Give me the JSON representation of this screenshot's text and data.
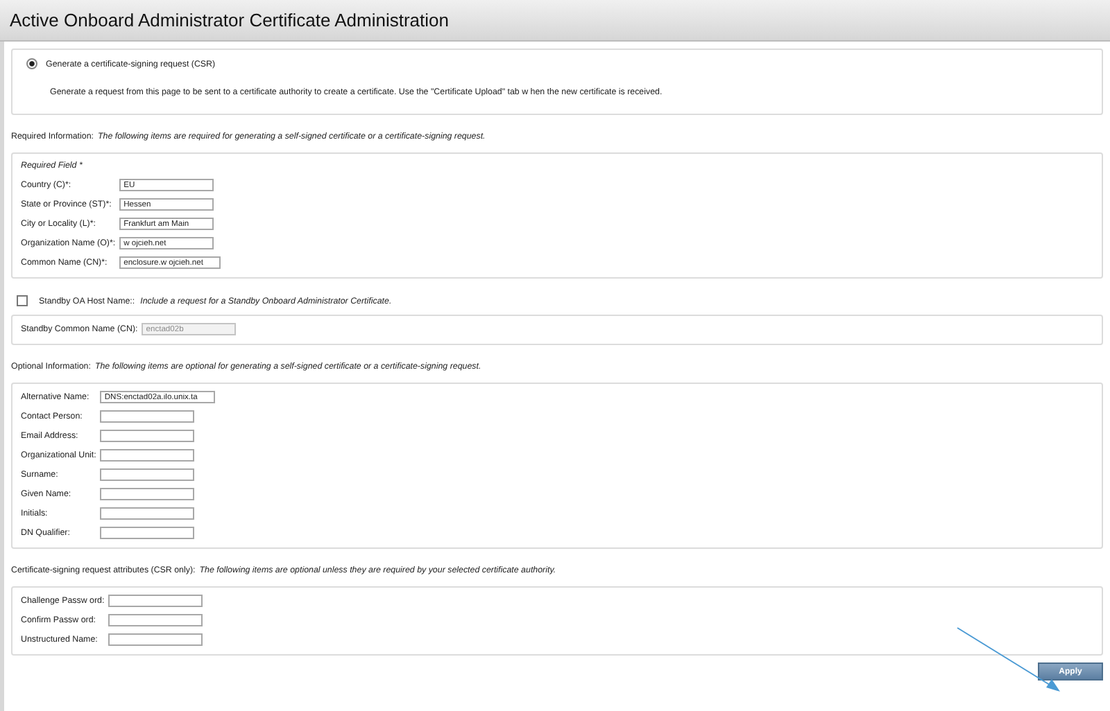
{
  "window": {
    "title": "Active Onboard Administrator Certificate Administration"
  },
  "blocks": [
    {
      "kind": "radio",
      "label": "Generate a certificate-signing request (CSR)",
      "selected": true,
      "description": "Generate a request from this page to be sent to a certificate authority to create a certificate. Use the \"Certificate Upload\" tab w hen the new  certificate is received."
    },
    {
      "kind": "heading",
      "label": "Required Information:",
      "note": "The following items are required for generating a self-signed certificate or a certificate-signing request."
    },
    {
      "kind": "fields",
      "legend": "Required Field *",
      "fields": [
        {
          "label": "Country (C)*:",
          "value": "EU"
        },
        {
          "label": "State or Province (ST)*:",
          "value": "Hessen"
        },
        {
          "label": "City or Locality (L)*:",
          "value": "Frankfurt am Main"
        },
        {
          "label": "Organization Name (O)*:",
          "value": "w ojcieh.net"
        },
        {
          "label": "Common Name (CN)*:",
          "value": "enclosure.w ojcieh.net"
        }
      ]
    },
    {
      "kind": "checkbox",
      "checked": false,
      "label": "Standby OA Host Name::",
      "note": "Include a request for a Standby Onboard Administrator Certificate."
    },
    {
      "kind": "fields",
      "fields": [
        {
          "label": "Standby Common Name (CN):",
          "value": "enctad02b",
          "disabled": true
        }
      ]
    },
    {
      "kind": "heading",
      "label": "Optional Information:",
      "note": "The following items are optional for generating a self-signed certificate or a certificate-signing request."
    },
    {
      "kind": "fields",
      "fields": [
        {
          "label": "Alternative Name:",
          "value": "DNS:enctad02a.ilo.unix.ta"
        },
        {
          "label": "Contact Person:"
        },
        {
          "label": "Email Address:"
        },
        {
          "label": "Organizational Unit:"
        },
        {
          "label": "Surname:"
        },
        {
          "label": "Given Name:"
        },
        {
          "label": "Initials:"
        },
        {
          "label": "DN Qualifier:"
        }
      ]
    },
    {
      "kind": "heading",
      "label": "Certificate-signing request attributes (CSR only):",
      "note": "The following items are optional unless they are required by your selected certificate authority."
    },
    {
      "kind": "fields",
      "fields": [
        {
          "label": "Challenge Passw ord:"
        },
        {
          "label": "Confirm Passw ord:"
        },
        {
          "label": "Unstructured Name:"
        }
      ]
    },
    {
      "kind": "button",
      "label": "Apply"
    }
  ]
}
